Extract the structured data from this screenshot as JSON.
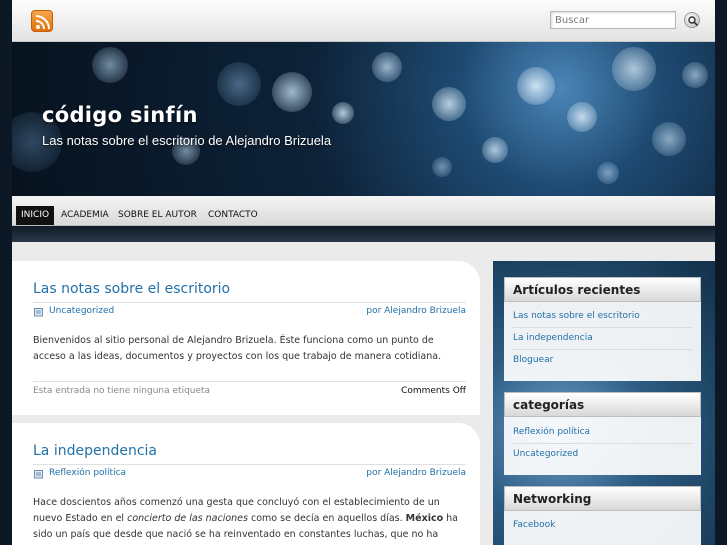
{
  "search": {
    "placeholder": "Buscar"
  },
  "header": {
    "title": "código sinfín",
    "description": "Las notas sobre el escritorio de Alejandro Brizuela"
  },
  "nav": {
    "items": [
      "INICIO",
      "ACADEMIA",
      "SOBRE EL AUTOR",
      "CONTACTO"
    ],
    "active": "INICIO"
  },
  "posts": [
    {
      "title": "Las notas sobre el escritorio",
      "category": "Uncategorized",
      "author": "por Alejandro Brizuela",
      "text": "Bienvenidos al sitio personal de Alejandro Brizuela. Éste funciona como un punto de acceso a las ideas, documentos y proyectos con los que trabajo de manera cotidiana.",
      "tags": "Esta entrada no tiene ninguna etiqueta",
      "comments": "Comments Off"
    },
    {
      "title": "La independencia",
      "category": "Reflexión política",
      "author": "por Alejandro Brizuela",
      "text_parts": [
        "Hace doscientos años comenzó una gesta que concluyó con el establecimiento de un nuevo Estado en el ",
        "concierto de las naciones",
        " como se decía en aquellos días. ",
        "México",
        " ha sido un país que desde que nació se ha reinventado en constantes luchas, que no ha terminado de atarse fuerte y que ha"
      ]
    }
  ],
  "sidebar": {
    "recent": {
      "title": "Artículos recientes",
      "items": [
        "Las notas sobre el escritorio",
        "La independencia",
        "Bloguear"
      ]
    },
    "categories": {
      "title": "categorías",
      "items": [
        "Reflexión política",
        "Uncategorized"
      ]
    },
    "networking": {
      "title": "Networking",
      "items": [
        "Facebook"
      ]
    }
  },
  "colors": {
    "link": "#2270a8",
    "nav_active_bg": "#111111",
    "rss": "#e3700c"
  }
}
